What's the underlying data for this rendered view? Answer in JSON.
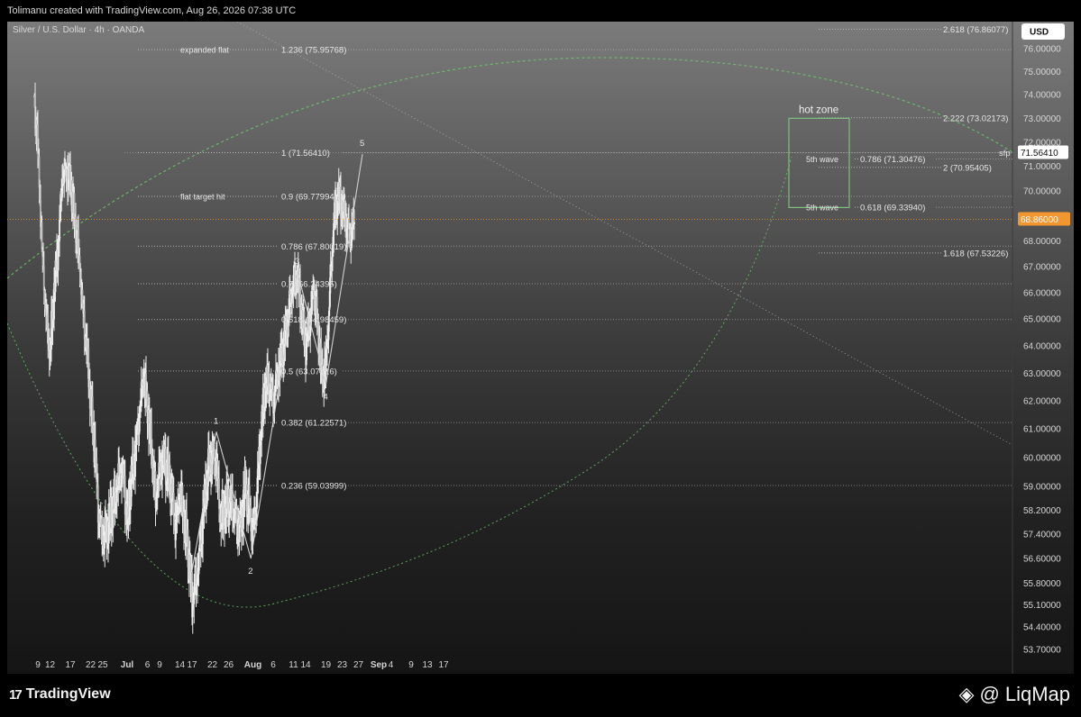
{
  "header": {
    "attribution": "Tolimanu created with TradingView.com, Aug 26, 2026 07:38 UTC"
  },
  "footer": {
    "tv_logo": "TradingView",
    "tv_mark": "17",
    "liqmap_logo": "LiqMap",
    "liqmap_at": "@"
  },
  "colors": {
    "accent_orange": "#f2962f",
    "fib_dotted": "#c8c8c8",
    "fan_green": "#6ec46e",
    "hot_zone": "#7fbf7f",
    "wave_line": "#d0d0d0"
  },
  "chart_data": {
    "type": "candlestick",
    "title": "Silver / U.S. Dollar · 4h · OANDA",
    "currency": "USD",
    "y_axis": {
      "ticks": [
        "76.00000",
        "75.00000",
        "74.00000",
        "73.00000",
        "72.00000",
        "71.00000",
        "70.00000",
        "69.00000",
        "68.00000",
        "67.00000",
        "66.00000",
        "65.00000",
        "64.00000",
        "63.00000",
        "62.00000",
        "61.00000",
        "60.00000",
        "59.00000",
        "58.20000",
        "57.40000",
        "56.60000",
        "55.80000",
        "55.10000",
        "54.40000",
        "53.70000"
      ],
      "scale": "log"
    },
    "x_axis": {
      "ticks": [
        {
          "label": "9",
          "day": 9
        },
        {
          "label": "12",
          "day": 12
        },
        {
          "label": "17",
          "day": 17
        },
        {
          "label": "22",
          "day": 22
        },
        {
          "label": "25",
          "day": 25
        },
        {
          "label": "Jul",
          "day": 31,
          "bold": true
        },
        {
          "label": "6",
          "day": 36
        },
        {
          "label": "9",
          "day": 39
        },
        {
          "label": "14",
          "day": 44
        },
        {
          "label": "17",
          "day": 47
        },
        {
          "label": "22",
          "day": 52
        },
        {
          "label": "26",
          "day": 56
        },
        {
          "label": "Aug",
          "day": 62,
          "bold": true
        },
        {
          "label": "6",
          "day": 67
        },
        {
          "label": "11",
          "day": 72
        },
        {
          "label": "14",
          "day": 75
        },
        {
          "label": "19",
          "day": 80
        },
        {
          "label": "23",
          "day": 84
        },
        {
          "label": "27",
          "day": 88
        },
        {
          "label": "Sep",
          "day": 93,
          "bold": true
        },
        {
          "label": "4",
          "day": 96
        },
        {
          "label": "9",
          "day": 101
        },
        {
          "label": "13",
          "day": 105
        },
        {
          "label": "17",
          "day": 109
        }
      ]
    },
    "price_marker": {
      "value": 68.86,
      "label": "68.86000"
    },
    "sfp_marker": {
      "value": 71.5641,
      "label": "71.56410",
      "tag": "sfp"
    },
    "fib_retracement": [
      {
        "label": "1.236 (75.95768)",
        "value": 75.95768
      },
      {
        "label": "1 (71.56410)",
        "value": 71.5641
      },
      {
        "label": "0.9 (69.77994)",
        "value": 69.77994
      },
      {
        "label": "0.786 (67.80019)",
        "value": 67.80019
      },
      {
        "label": "0.7 (66.34395)",
        "value": 66.34395
      },
      {
        "label": "0.618 (64.98459)",
        "value": 64.98459
      },
      {
        "label": "0.5 (63.07716)",
        "value": 63.07716
      },
      {
        "label": "0.382 (61.22571)",
        "value": 61.22571
      },
      {
        "label": "0.236 (59.03999)",
        "value": 59.03999
      }
    ],
    "fib_extension": [
      {
        "label": "2.618 (76.86077)",
        "value": 76.86077
      },
      {
        "label": "2.222 (73.02173)",
        "value": 73.02173
      },
      {
        "label": "0.786 (71.30476)",
        "value": 71.30476
      },
      {
        "label": "2 (70.95405)",
        "value": 70.95405
      },
      {
        "label": "0.618 (69.33940)",
        "value": 69.3394
      },
      {
        "label": "1.618 (67.53226)",
        "value": 67.53226
      }
    ],
    "annotations": [
      {
        "text": "expanded flat",
        "value": 75.95768
      },
      {
        "text": "flat target hit",
        "value": 69.77994
      },
      {
        "text": "hot zone",
        "value": 73.4
      },
      {
        "text": "5th wave",
        "value": 71.30476
      },
      {
        "text": "5th wave",
        "value": 69.3394
      }
    ],
    "hot_zone": {
      "top": 73.0,
      "bottom": 69.33
    },
    "waves": [
      {
        "label": "1",
        "day": 53,
        "value": 60.9
      },
      {
        "label": "2",
        "day": 61.5,
        "value": 56.6
      },
      {
        "label": "3",
        "day": 73,
        "value": 66.8
      },
      {
        "label": "4",
        "day": 80,
        "value": 62.6
      },
      {
        "label": "5",
        "day": 89,
        "value": 71.5
      }
    ],
    "wave_start": {
      "day": 47,
      "value": 56.2
    },
    "price_path": [
      [
        8,
        73.9
      ],
      [
        9,
        71.7
      ],
      [
        10,
        67.7
      ],
      [
        11,
        65.0
      ],
      [
        12,
        63.8
      ],
      [
        13,
        66.1
      ],
      [
        14,
        67.8
      ],
      [
        15,
        70.5
      ],
      [
        16,
        70.8
      ],
      [
        17,
        70.4
      ],
      [
        18,
        68.9
      ],
      [
        19,
        67.6
      ],
      [
        20,
        65.5
      ],
      [
        21,
        63.9
      ],
      [
        22,
        62.0
      ],
      [
        23,
        60.3
      ],
      [
        24,
        58.0
      ],
      [
        25,
        57.2
      ],
      [
        26,
        57.6
      ],
      [
        27,
        58.1
      ],
      [
        28,
        58.6
      ],
      [
        29,
        59.4
      ],
      [
        30,
        59.5
      ],
      [
        31,
        57.8
      ],
      [
        32,
        59.2
      ],
      [
        33,
        60.2
      ],
      [
        34,
        61.5
      ],
      [
        35,
        62.9
      ],
      [
        36,
        61.8
      ],
      [
        37,
        60.3
      ],
      [
        38,
        58.6
      ],
      [
        39,
        59.6
      ],
      [
        40,
        60.0
      ],
      [
        41,
        59.5
      ],
      [
        42,
        58.7
      ],
      [
        43,
        57.6
      ],
      [
        44,
        58.9
      ],
      [
        45,
        57.9
      ],
      [
        46,
        57.0
      ],
      [
        47,
        55.3
      ],
      [
        48,
        55.9
      ],
      [
        49,
        57.0
      ],
      [
        50,
        58.5
      ],
      [
        51,
        59.6
      ],
      [
        52,
        60.0
      ],
      [
        53,
        59.8
      ],
      [
        54,
        57.9
      ],
      [
        55,
        58.2
      ],
      [
        56,
        58.6
      ],
      [
        57,
        58.4
      ],
      [
        58,
        57.8
      ],
      [
        59,
        57.6
      ],
      [
        60,
        59.0
      ],
      [
        61,
        58.3
      ],
      [
        62,
        57.4
      ],
      [
        63,
        58.7
      ],
      [
        64,
        61.0
      ],
      [
        65,
        62.5
      ],
      [
        66,
        62.8
      ],
      [
        67,
        62.0
      ],
      [
        68,
        63.0
      ],
      [
        69,
        63.6
      ],
      [
        70,
        64.4
      ],
      [
        71,
        65.4
      ],
      [
        72,
        66.3
      ],
      [
        73,
        66.6
      ],
      [
        74,
        65.2
      ],
      [
        75,
        64.0
      ],
      [
        76,
        65.0
      ],
      [
        77,
        66.2
      ],
      [
        78,
        64.8
      ],
      [
        79,
        62.8
      ],
      [
        80,
        63.3
      ],
      [
        81,
        66.0
      ],
      [
        82,
        68.9
      ],
      [
        83,
        69.8
      ],
      [
        84,
        69.4
      ],
      [
        85,
        68.8
      ],
      [
        86,
        68.2
      ],
      [
        87,
        68.9
      ]
    ]
  }
}
